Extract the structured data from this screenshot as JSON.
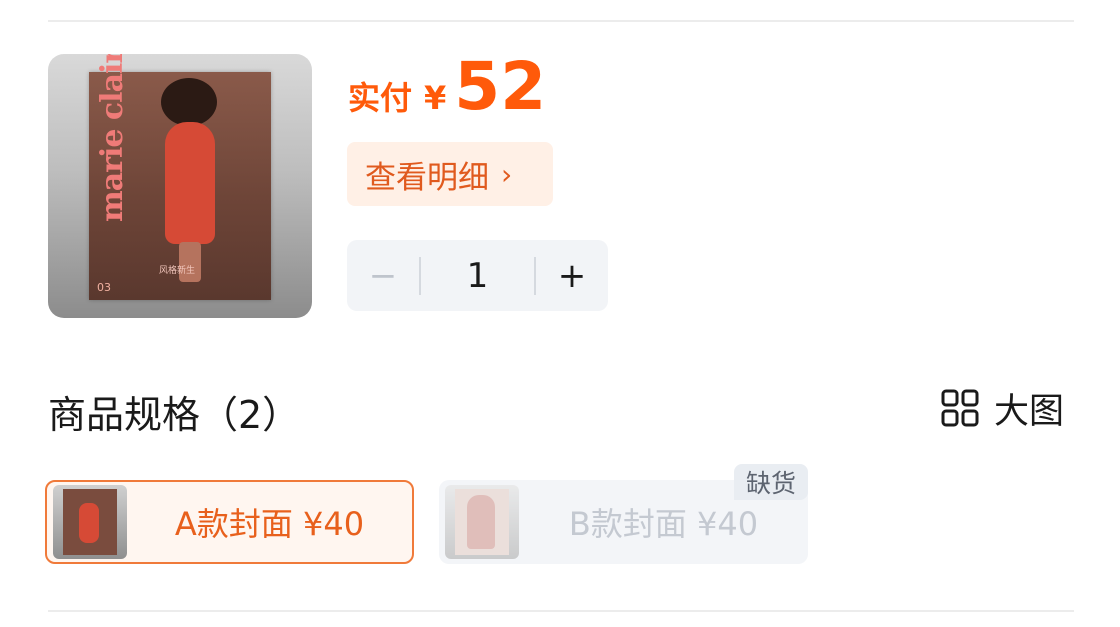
{
  "product": {
    "image_icon": "magazine-cover",
    "cover": {
      "masthead": "marie claire",
      "issue_number": "03",
      "subtitle": "风格新生"
    }
  },
  "price": {
    "label": "实付",
    "currency": "¥",
    "value": "52"
  },
  "detail_button": {
    "label": "查看明细",
    "icon": "chevron-right-icon"
  },
  "stepper": {
    "minus": "−",
    "value": "1",
    "plus": "+"
  },
  "specs": {
    "title": "商品规格（2）",
    "big_view_label": "大图",
    "big_view_icon": "grid-icon",
    "options": [
      {
        "label": "A款封面  ¥40",
        "selected": true
      },
      {
        "label": "B款封面  ¥40",
        "selected": false,
        "badge": "缺货"
      }
    ]
  },
  "colors": {
    "accent": "#ff5a0a",
    "accent_bg": "#fff0e6",
    "neutral_bg": "#f2f4f7"
  }
}
